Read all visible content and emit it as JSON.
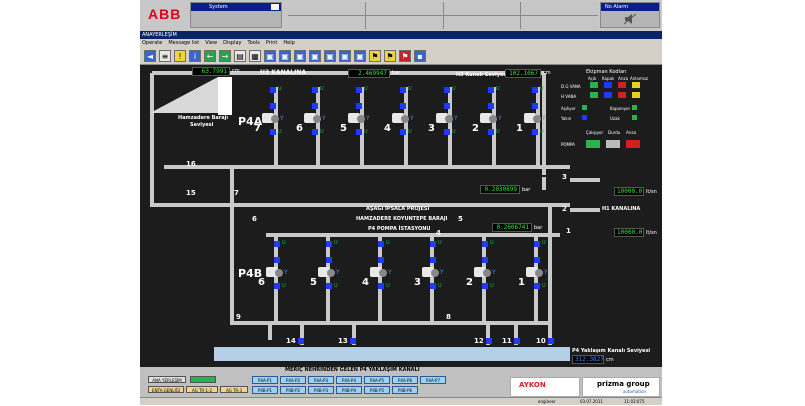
{
  "header": {
    "logo": "ABB",
    "alarm_panel_label": "System",
    "no_alarm_label": "No Alarm"
  },
  "window": {
    "title": "ANAYERLEŞİM",
    "menu": [
      "Operate",
      "Message list",
      "View",
      "Display",
      "Tools",
      "Print",
      "Help"
    ]
  },
  "toolbar": {
    "icons": [
      "prev-icon",
      "list-icon",
      "warning-icon",
      "info-icon",
      "back-icon",
      "forward-icon",
      "print-icon",
      "grid-icon",
      "panel-icon",
      "panel-icon",
      "panel-icon",
      "panel-icon",
      "panel-icon",
      "panel-icon",
      "panel-icon",
      "flag-icon",
      "flag-icon",
      "flag-icon",
      "save-icon"
    ]
  },
  "process": {
    "reservoir_level": "63.7991",
    "reservoir_unit": "cm",
    "reservoir_label_1": "Hamzadere Barajı",
    "reservoir_label_2": "Seviyesi",
    "h3_label": "H3 KANALINA",
    "h3_pressure": "2.469947",
    "h3_unit": "bar",
    "h3_canal_label": "H3 Kanalı Seviyesi",
    "h3_canal_level": "102.1067",
    "h3_canal_unit": "cm",
    "p4a_label": "P4A",
    "p4b_label": "P4B",
    "p4a_pumps": [
      "7",
      "6",
      "5",
      "4",
      "3",
      "2",
      "1"
    ],
    "p4b_pumps": [
      "6",
      "5",
      "4",
      "3",
      "2",
      "1"
    ],
    "valve_16": "16",
    "valve_15": "15",
    "valve_7": "7",
    "valve_6": "6",
    "valve_5": "5",
    "valve_4": "4",
    "valve_3": "3",
    "valve_2": "2",
    "valve_1": "1",
    "valve_9": "9",
    "valve_8": "8",
    "bottom_valves": [
      "14",
      "13",
      "12",
      "11",
      "10"
    ],
    "mid_pressure_1": "0.2030899",
    "mid_pressure_2": "0.2606741",
    "pressure_unit": "bar",
    "flow_1": "10000.0",
    "flow_2": "10000.0",
    "flow_unit": "lt/sn",
    "h1_label": "H1 KANALINA",
    "project_title_1": "AŞAĞI İPSALA PROJESİ",
    "project_title_2": "HAMZADERE KOYUNTEPE BARAJI",
    "project_title_3": "P4 POMPA İSTASYONU",
    "p4_canal_label": "P4 Yaklaşım Kanalı Seviyesi",
    "p4_canal_level": "312.3827",
    "p4_canal_unit": "cm"
  },
  "legend": {
    "title": "Ekipman Kodları",
    "cols": [
      "Açık",
      "Kapalı",
      "Arıza",
      "Anlamsız"
    ],
    "rows": [
      "D.G VANA",
      "H VANA"
    ],
    "items": [
      "Aşılıyor",
      "Kapanıyor",
      "Yakın",
      "Uzak"
    ],
    "pump_cols": [
      "Çalışıyor",
      "Durdu",
      "Arıza"
    ],
    "pump_row": "POMPA"
  },
  "bottom": {
    "canal_title": "MERİÇ NEHRİNDEN GELEN P4 YAKLAŞIM KANALI",
    "btn_ana": "ANA YERLEŞİM",
    "btn_green": "",
    "btn_enta": "ENTA.GENLİĞİ",
    "btn_ag1": "AG TR-1-2",
    "btn_ag3": "AG TR-3",
    "p_buttons_row1": [
      "P4A-P1",
      "P4A-P2",
      "P4A-P3",
      "P4A-P4",
      "P4A-P5",
      "P4A-P6",
      "P4A-P7"
    ],
    "p_buttons_row2": [
      "P4B-P1",
      "P4B-P2",
      "P4B-P3",
      "P4B-P4",
      "P4B-P5",
      "P4B-P6"
    ],
    "aykon": "AYKON",
    "prizma": "prizma group",
    "prizma_sub": "automation",
    "status_user": "engineer",
    "status_date": "03.07.2011",
    "status_time": "11:03:075"
  },
  "colors": {
    "pipe": "#c9c9c9",
    "pump_blue": "#1e3cff",
    "valve_green": "#2ab34a",
    "readout_green": "#34e834"
  }
}
